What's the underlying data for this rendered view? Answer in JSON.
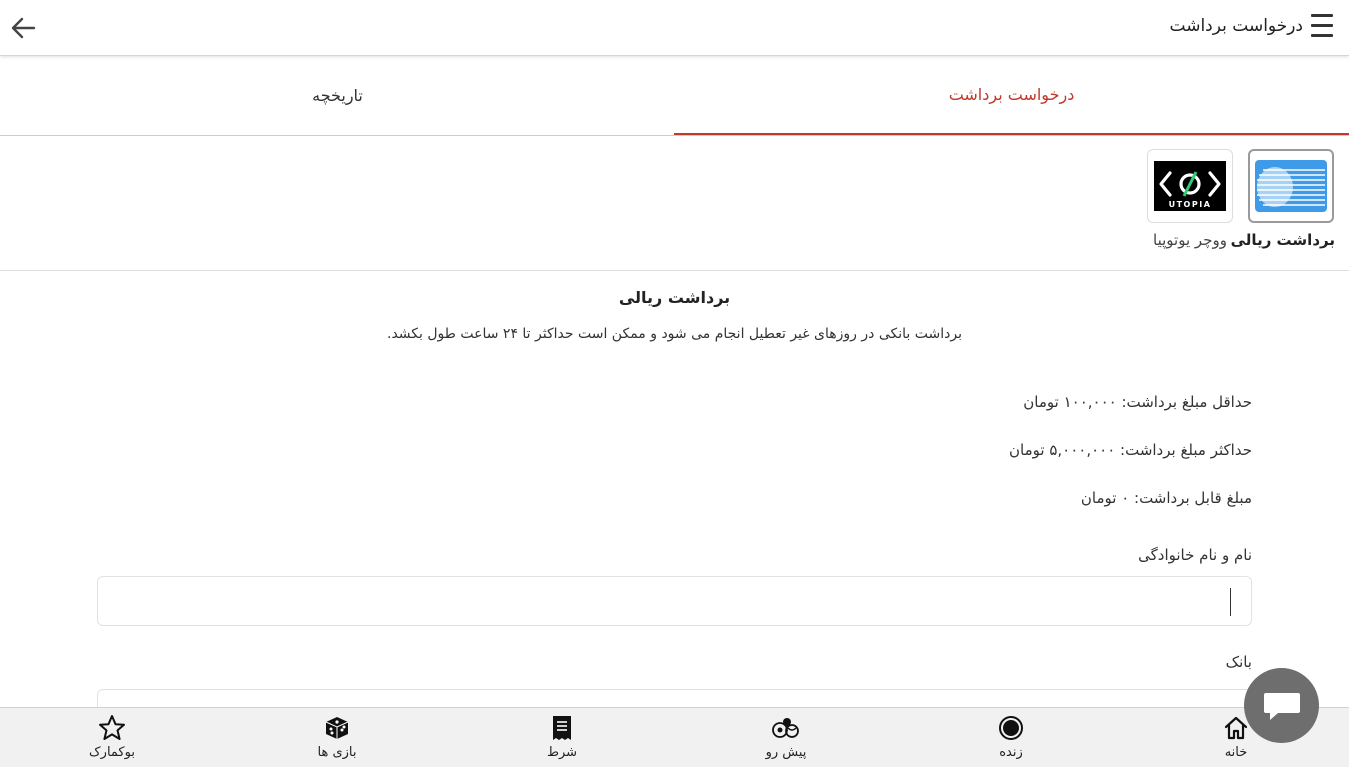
{
  "header": {
    "title": "درخواست برداشت"
  },
  "tabs": [
    {
      "label": "درخواست برداشت",
      "active": true
    },
    {
      "label": "تاریخچه",
      "active": false
    }
  ],
  "methods": [
    {
      "label": "برداشت ریالی",
      "icon": "rial-withdraw-icon",
      "selected": true
    },
    {
      "label": "ووچر یوتوپیا",
      "icon": "utopia-logo",
      "logo_text": "UTOPIA",
      "selected": false
    }
  ],
  "section": {
    "title": "برداشت ریالی",
    "description": "برداشت بانکی در روزهای غیر تعطیل انجام می شود و ممکن است حداکثر تا ۲۴ ساعت طول بکشد.",
    "min_amount": "حداقل مبلغ برداشت: ۱۰۰,۰۰۰ تومان",
    "max_amount": "حداکثر مبلغ برداشت: ۵,۰۰۰,۰۰۰ تومان",
    "available": "مبلغ قابل برداشت: ۰ تومان"
  },
  "form": {
    "name_label": "نام و نام خانوادگی",
    "name_value": "",
    "bank_label": "بانک"
  },
  "nav": [
    {
      "label": "خانه",
      "icon": "home-icon"
    },
    {
      "label": "زنده",
      "icon": "live-icon"
    },
    {
      "label": "پیش رو",
      "icon": "upcoming-sports-icon"
    },
    {
      "label": "شرط",
      "icon": "betslip-icon"
    },
    {
      "label": "بازی ها",
      "icon": "dice-icon"
    },
    {
      "label": "بوکمارک",
      "icon": "star-icon"
    }
  ],
  "colors": {
    "accent": "#c0392b",
    "rial_icon_blue": "#3f9be8",
    "nav_bg": "#f1f1f1",
    "chat_button": "#6e6e6e"
  }
}
